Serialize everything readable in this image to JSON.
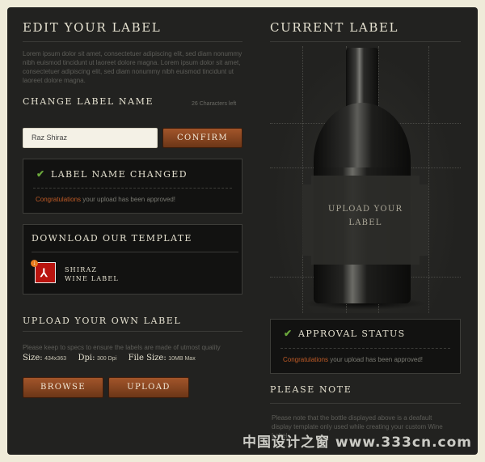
{
  "edit": {
    "title": "EDIT YOUR LABEL",
    "lorem": "Lorem ipsum dolor sit amet, consectetuer adipiscing elit, sed diam nonummy nibh euismod tincidunt ut laoreet dolore magna. Lorem ipsum dolor sit amet, consectetuer adipiscing elit, sed diam nonummy nibh euismod tincidunt ut laoreet dolore magna."
  },
  "change": {
    "title": "CHANGE LABEL NAME",
    "chars_left": "26 Characters left",
    "input_value": "Raz Shiraz",
    "confirm_label": "CONFIRM"
  },
  "changed_box": {
    "title": "LABEL NAME CHANGED",
    "msg_highlight": "Congratulations",
    "msg_rest": " your upload has been approved!"
  },
  "download": {
    "title": "DOWNLOAD OUR TEMPLATE",
    "file_line1": "SHIRAZ",
    "file_line2": "WINE LABEL"
  },
  "upload": {
    "title": "UPLOAD YOUR OWN LABEL",
    "keep_specs": "Please keep to specs to ensure the labels are made of utmost quality",
    "size_label": "Size:",
    "size_value": "434x363",
    "dpi_label": "Dpi:",
    "dpi_value": "300 Dpi",
    "filesize_label": "File Size:",
    "filesize_value": "10MB Max",
    "browse_label": "BROWSE",
    "upload_label": "UPLOAD"
  },
  "current": {
    "title": "CURRENT LABEL",
    "label_line1": "UPLOAD YOUR",
    "label_line2": "LABEL"
  },
  "approval": {
    "title": "APPROVAL STATUS",
    "msg_highlight": "Congratulations",
    "msg_rest": " your upload has been approved!"
  },
  "note": {
    "title": "PLEASE NOTE",
    "text": "Please note that the bottle displayed above is a deafault display template only used while creating your custom Wine Label."
  },
  "watermark": "中国设计之窗 www.333cn.com",
  "icons": {
    "check": "check-icon",
    "pdf": "pdf-icon",
    "download": "download-icon"
  },
  "colors": {
    "accent": "#c05b26",
    "button": "#8a4520",
    "check": "#6ba83c"
  }
}
